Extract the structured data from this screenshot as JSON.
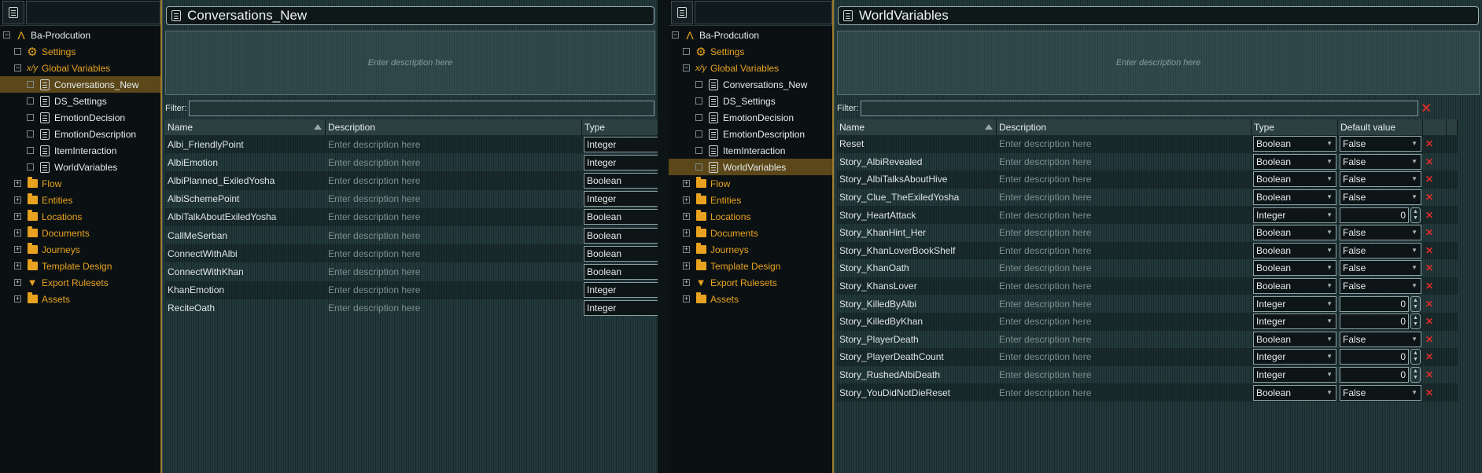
{
  "tree": {
    "root": "Ba-Prodcution",
    "items": [
      {
        "label": "Settings",
        "icon": "gear-icon",
        "level": 1,
        "expander": "empty",
        "color": "orange"
      },
      {
        "label": "Global Variables",
        "icon": "variables-icon",
        "level": 1,
        "expander": "minus",
        "color": "orange"
      },
      {
        "label": "Conversations_New",
        "icon": "document-icon",
        "level": 2,
        "expander": "empty",
        "color": "white"
      },
      {
        "label": "DS_Settings",
        "icon": "document-icon",
        "level": 2,
        "expander": "empty",
        "color": "white"
      },
      {
        "label": "EmotionDecision",
        "icon": "document-icon",
        "level": 2,
        "expander": "empty",
        "color": "white"
      },
      {
        "label": "EmotionDescription",
        "icon": "document-icon",
        "level": 2,
        "expander": "empty",
        "color": "white"
      },
      {
        "label": "ItemInteraction",
        "icon": "document-icon",
        "level": 2,
        "expander": "empty",
        "color": "white"
      },
      {
        "label": "WorldVariables",
        "icon": "document-icon",
        "level": 2,
        "expander": "empty",
        "color": "white"
      },
      {
        "label": "Flow",
        "icon": "folder-icon",
        "level": 1,
        "expander": "plus",
        "color": "orange"
      },
      {
        "label": "Entities",
        "icon": "folder-icon",
        "level": 1,
        "expander": "plus",
        "color": "orange"
      },
      {
        "label": "Locations",
        "icon": "folder-icon",
        "level": 1,
        "expander": "plus",
        "color": "orange"
      },
      {
        "label": "Documents",
        "icon": "folder-icon",
        "level": 1,
        "expander": "plus",
        "color": "orange"
      },
      {
        "label": "Journeys",
        "icon": "folder-icon",
        "level": 1,
        "expander": "plus",
        "color": "orange"
      },
      {
        "label": "Template Design",
        "icon": "folder-icon",
        "level": 1,
        "expander": "plus",
        "color": "orange"
      },
      {
        "label": "Export Rulesets",
        "icon": "funnel-icon",
        "level": 1,
        "expander": "plus",
        "color": "orange"
      },
      {
        "label": "Assets",
        "icon": "folder-icon",
        "level": 1,
        "expander": "plus",
        "color": "orange"
      }
    ]
  },
  "left": {
    "title": "Conversations_New",
    "desc_placeholder": "Enter description here",
    "filter_label": "Filter:",
    "cols": [
      "Name",
      "Description",
      "Type"
    ],
    "rows": [
      [
        "Albi_FriendlyPoint",
        "Enter description here",
        "Integer"
      ],
      [
        "AlbiEmotion",
        "Enter description here",
        "Integer"
      ],
      [
        "AlbiPlanned_ExiledYosha",
        "Enter description here",
        "Boolean"
      ],
      [
        "AlbiSchemePoint",
        "Enter description here",
        "Integer"
      ],
      [
        "AlbiTalkAboutExiledYosha",
        "Enter description here",
        "Boolean"
      ],
      [
        "CallMeSerban",
        "Enter description here",
        "Boolean"
      ],
      [
        "ConnectWithAlbi",
        "Enter description here",
        "Boolean"
      ],
      [
        "ConnectWithKhan",
        "Enter description here",
        "Boolean"
      ],
      [
        "KhanEmotion",
        "Enter description here",
        "Integer"
      ],
      [
        "ReciteOath",
        "Enter description here",
        "Integer"
      ]
    ]
  },
  "right": {
    "title": "WorldVariables",
    "desc_placeholder": "Enter description here",
    "filter_label": "Filter:",
    "cols": [
      "Name",
      "Description",
      "Type",
      "Default value"
    ],
    "rows": [
      [
        "Reset",
        "Enter description here",
        "Boolean",
        "False"
      ],
      [
        "Story_AlbiRevealed",
        "Enter description here",
        "Boolean",
        "False"
      ],
      [
        "Story_AlbiTalksAboutHive",
        "Enter description here",
        "Boolean",
        "False"
      ],
      [
        "Story_Clue_TheExiledYosha",
        "Enter description here",
        "Boolean",
        "False"
      ],
      [
        "Story_HeartAttack",
        "Enter description here",
        "Integer",
        "0"
      ],
      [
        "Story_KhanHint_Her",
        "Enter description here",
        "Boolean",
        "False"
      ],
      [
        "Story_KhanLoverBookShelf",
        "Enter description here",
        "Boolean",
        "False"
      ],
      [
        "Story_KhanOath",
        "Enter description here",
        "Boolean",
        "False"
      ],
      [
        "Story_KhansLover",
        "Enter description here",
        "Boolean",
        "False"
      ],
      [
        "Story_KilledByAlbi",
        "Enter description here",
        "Integer",
        "0"
      ],
      [
        "Story_KilledByKhan",
        "Enter description here",
        "Integer",
        "0"
      ],
      [
        "Story_PlayerDeath",
        "Enter description here",
        "Boolean",
        "False"
      ],
      [
        "Story_PlayerDeathCount",
        "Enter description here",
        "Integer",
        "0"
      ],
      [
        "Story_RushedAlbiDeath",
        "Enter description here",
        "Integer",
        "0"
      ],
      [
        "Story_YouDidNotDieReset",
        "Enter description here",
        "Boolean",
        "False"
      ]
    ]
  },
  "colors": {
    "accent": "#e9a21f",
    "delete": "#e02a2a",
    "selection": "#5b4719"
  }
}
